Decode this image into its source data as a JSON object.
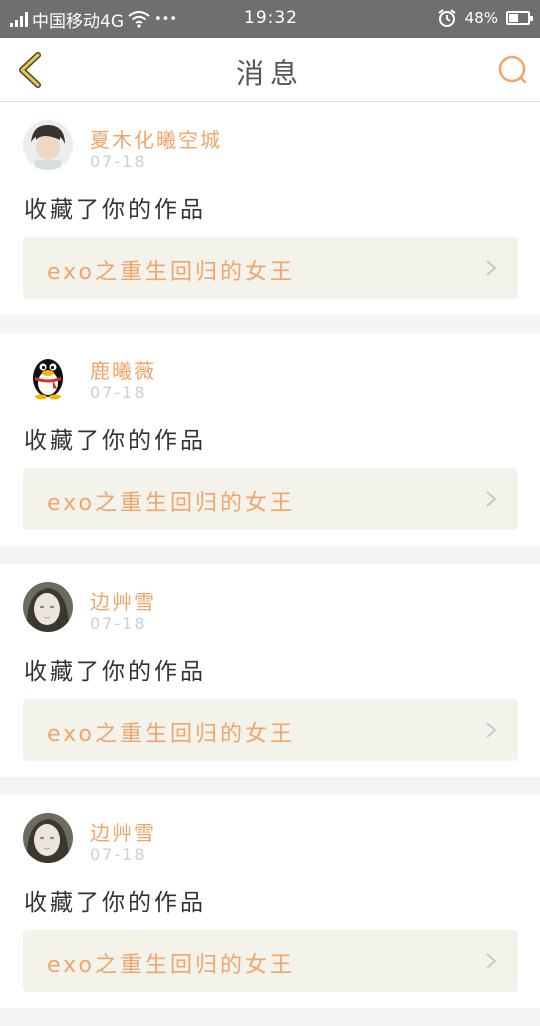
{
  "status_bar": {
    "carrier": "中国移动4G",
    "more": "•••",
    "time": "19:32",
    "battery": "48%",
    "battery_level": 0.48,
    "icons": [
      "signal-icon",
      "wifi-icon",
      "alarm-icon",
      "battery-icon"
    ]
  },
  "header": {
    "title": "消息",
    "back_icon": "chevron-left-icon",
    "search_icon": "search-icon"
  },
  "colors": {
    "accent": "#f0a56a",
    "back_arrow": "#e8c93a",
    "status_bar_bg": "#6f6f6f"
  },
  "messages": [
    {
      "avatar": "photo-avatar",
      "username": "夏木化曦空城",
      "date": "07-18",
      "action": "收藏了你的作品",
      "work_title": "exo之重生回归的女王"
    },
    {
      "avatar": "penguin-avatar",
      "username": "鹿曦薇",
      "date": "07-18",
      "action": "收藏了你的作品",
      "work_title": "exo之重生回归的女王"
    },
    {
      "avatar": "photo-avatar",
      "username": "边艸雪",
      "date": "07-18",
      "action": "收藏了你的作品",
      "work_title": "exo之重生回归的女王"
    },
    {
      "avatar": "photo-avatar",
      "username": "边艸雪",
      "date": "07-18",
      "action": "收藏了你的作品",
      "work_title": "exo之重生回归的女王"
    }
  ]
}
